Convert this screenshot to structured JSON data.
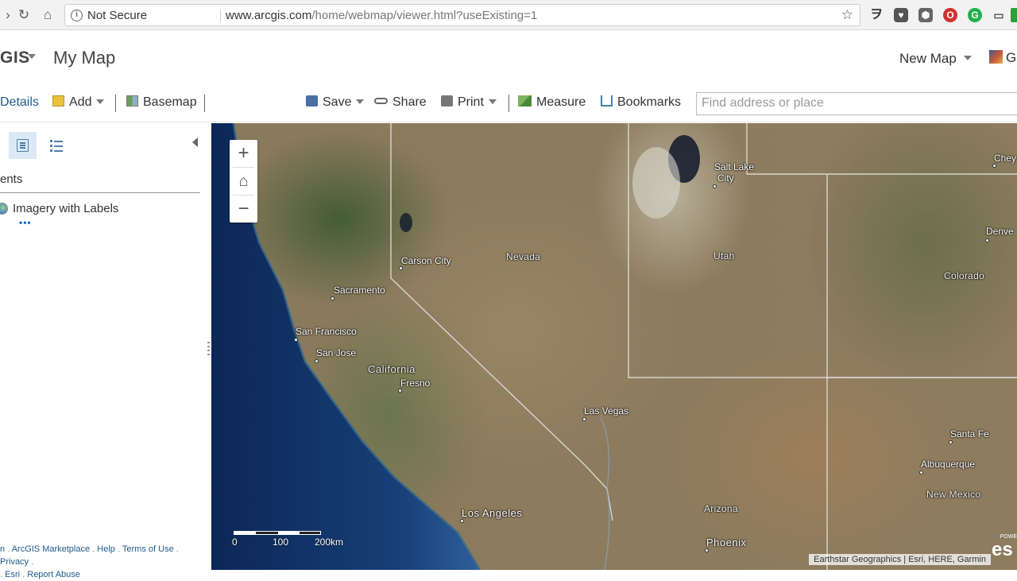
{
  "browser": {
    "security_label": "Not Secure",
    "url_host": "www.arcgis.com",
    "url_path": "/home/webmap/viewer.html?useExisting=1"
  },
  "header": {
    "brand": "GIS",
    "map_title": "My Map",
    "new_map_label": "New Map",
    "user_initial": "G"
  },
  "toolbar": {
    "details_label": "Details",
    "add_label": "Add",
    "basemap_label": "Basemap",
    "save_label": "Save",
    "share_label": "Share",
    "print_label": "Print",
    "measure_label": "Measure",
    "bookmarks_label": "Bookmarks",
    "search_placeholder": "Find address or place"
  },
  "panel": {
    "section_title": "ents",
    "layers": [
      {
        "name": "Imagery with Labels",
        "more": "•••"
      }
    ],
    "footer_links": [
      "ArcGIS Marketplace",
      "Help",
      "Terms of Use",
      "Privacy",
      "Esri",
      "Report Abuse"
    ],
    "footer_leading": "n"
  },
  "map": {
    "labels": {
      "salt_lake_city_1": "Salt Lake",
      "salt_lake_city_2": "City",
      "cheyenne": "Chey",
      "denver": "Denve",
      "carson_city": "Carson City",
      "nevada": "Nevada",
      "utah": "Utah",
      "colorado": "Colorado",
      "sacramento": "Sacramento",
      "san_francisco": "San Francisco",
      "san_jose": "San Jose",
      "california": "California",
      "fresno": "Fresno",
      "las_vegas": "Las Vegas",
      "santa_fe": "Santa Fe",
      "albuquerque": "Albuquerque",
      "new_mexico": "New Mexico",
      "los_angeles": "Los Angeles",
      "arizona": "Arizona",
      "phoenix": "Phoenix"
    },
    "scale_labels": [
      "0",
      "100",
      "200km"
    ],
    "attribution": "Earthstar Geographics | Esri, HERE, Garmin",
    "powered_by": "POWE",
    "esri_logo_text": "es"
  },
  "colors": {
    "accent": "#1e5a8c",
    "ocean_deep": "#0d2a5a",
    "ocean_coast": "#2e5f9a"
  }
}
